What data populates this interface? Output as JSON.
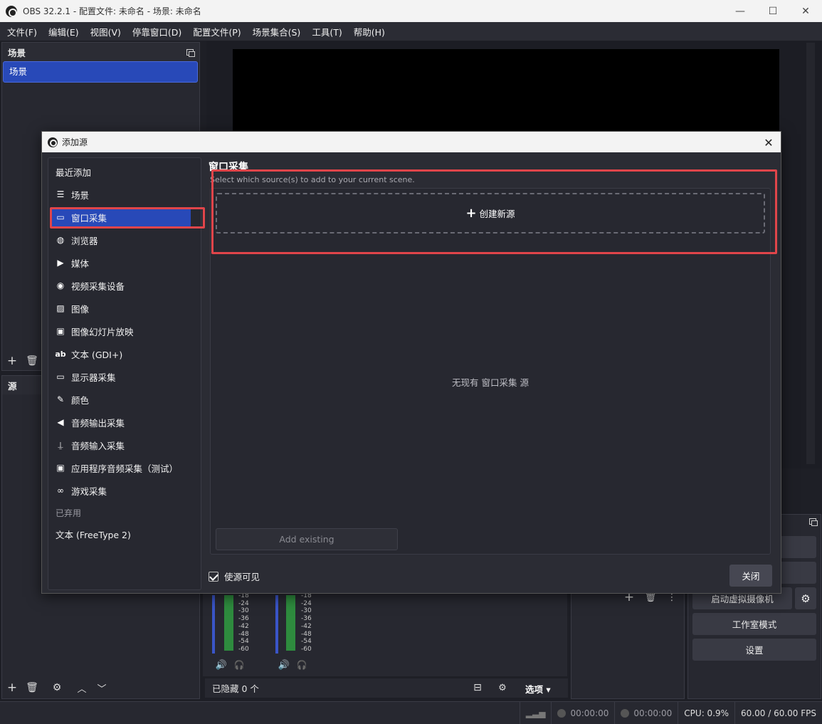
{
  "window": {
    "title": "OBS 32.2.1 - 配置文件: 未命名 - 场景: 未命名",
    "minimize": "—",
    "maximize": "☐",
    "close": "✕"
  },
  "menu": [
    "文件(F)",
    "编辑(E)",
    "视图(V)",
    "停靠窗口(D)",
    "配置文件(P)",
    "场景集合(S)",
    "工具(T)",
    "帮助(H)"
  ],
  "scenes_dock": {
    "title": "场景",
    "items": [
      "场景"
    ]
  },
  "sources_dock": {
    "title": "源"
  },
  "mixer": {
    "ticks": [
      "-18",
      "-24",
      "-30",
      "-36",
      "-42",
      "-48",
      "-54",
      "-60"
    ]
  },
  "sources_bottom": {
    "hidden_count": "已隐藏 0 个",
    "options": "选项"
  },
  "controls": {
    "virtual_cam": "启动虚拟摄像机",
    "studio_mode": "工作室模式",
    "settings": "设置"
  },
  "status": {
    "rec_time": "00:00:00",
    "stream_time": "00:00:00",
    "cpu": "CPU: 0.9%",
    "fps": "60.00 / 60.00 FPS"
  },
  "dialog": {
    "title": "添加源",
    "close": "✕",
    "recent_label": "最近添加",
    "types": [
      {
        "label": "场景",
        "icon": "list-icon"
      },
      {
        "label": "窗口采集",
        "icon": "window-icon"
      },
      {
        "label": "浏览器",
        "icon": "globe-icon"
      },
      {
        "label": "媒体",
        "icon": "play-icon"
      },
      {
        "label": "视频采集设备",
        "icon": "camera-icon"
      },
      {
        "label": "图像",
        "icon": "image-icon"
      },
      {
        "label": "图像幻灯片放映",
        "icon": "slideshow-icon"
      },
      {
        "label": "文本 (GDI+)",
        "icon": "text-icon"
      },
      {
        "label": "显示器采集",
        "icon": "monitor-icon"
      },
      {
        "label": "颜色",
        "icon": "brush-icon"
      },
      {
        "label": "音频输出采集",
        "icon": "speaker-icon"
      },
      {
        "label": "音频输入采集",
        "icon": "mic-icon"
      },
      {
        "label": "应用程序音频采集（测试）",
        "icon": "app-audio-icon"
      },
      {
        "label": "游戏采集",
        "icon": "gamepad-icon"
      }
    ],
    "deprecated_label": "已弃用",
    "deprecated_items": [
      "文本 (FreeType 2)"
    ],
    "selected_title": "窗口采集",
    "hint": "Select which source(s) to add to your current scene.",
    "create_new": "创建新源",
    "empty_note": "无现有 窗口采集 源",
    "add_existing": "Add existing",
    "make_visible": "使源可见",
    "close_button": "关闭"
  }
}
